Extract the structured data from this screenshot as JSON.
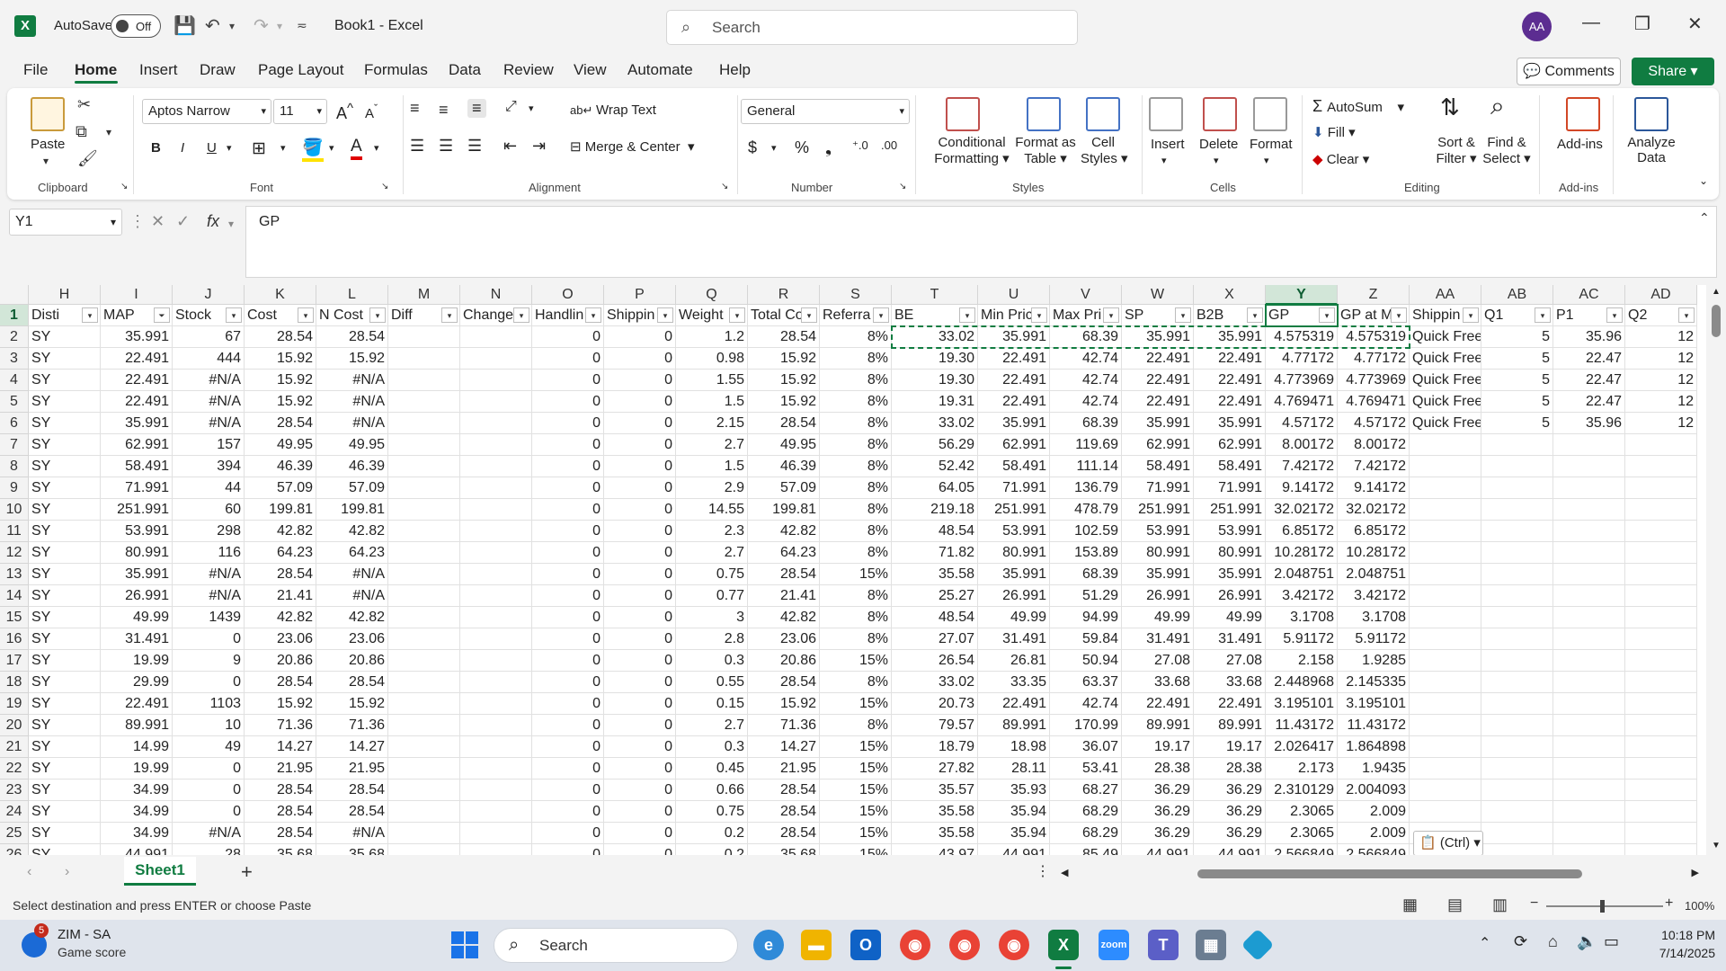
{
  "titlebar": {
    "autosave_label": "AutoSave",
    "autosave_state": "Off",
    "book_title": "Book1  -  Excel",
    "search_placeholder": "Search",
    "avatar_initials": "AA"
  },
  "menu": [
    "File",
    "Home",
    "Insert",
    "Draw",
    "Page Layout",
    "Formulas",
    "Data",
    "Review",
    "View",
    "Automate",
    "Help"
  ],
  "actions": {
    "comments": "Comments",
    "share": "Share"
  },
  "ribbon": {
    "clipboard": {
      "paste": "Paste",
      "label": "Clipboard"
    },
    "font": {
      "name": "Aptos Narrow",
      "size": "11",
      "label": "Font"
    },
    "alignment": {
      "wrap": "Wrap Text",
      "merge": "Merge & Center",
      "label": "Alignment"
    },
    "number": {
      "format": "General",
      "label": "Number"
    },
    "styles": {
      "conditional": [
        "Conditional",
        "Formatting"
      ],
      "format_table": [
        "Format as",
        "Table"
      ],
      "cell_styles": [
        "Cell",
        "Styles"
      ],
      "label": "Styles"
    },
    "cells": {
      "insert": "Insert",
      "delete": "Delete",
      "format": "Format",
      "label": "Cells"
    },
    "editing": {
      "autosum": "AutoSum",
      "fill": "Fill",
      "clear": "Clear",
      "sort": [
        "Sort &",
        "Filter"
      ],
      "find": [
        "Find &",
        "Select"
      ],
      "label": "Editing"
    },
    "addins": {
      "addins": "Add-ins",
      "label": "Add-ins",
      "analyze": [
        "Analyze",
        "Data"
      ]
    }
  },
  "formula_bar": {
    "name_box": "Y1",
    "fx": "fx",
    "content": "GP"
  },
  "columns": [
    {
      "letter": "H",
      "w": 80,
      "header": "Disti",
      "txt": true
    },
    {
      "letter": "I",
      "w": 80,
      "header": "MAP"
    },
    {
      "letter": "J",
      "w": 80,
      "header": "Stock"
    },
    {
      "letter": "K",
      "w": 80,
      "header": "Cost"
    },
    {
      "letter": "L",
      "w": 80,
      "header": "N Cost"
    },
    {
      "letter": "M",
      "w": 80,
      "header": "Diff"
    },
    {
      "letter": "N",
      "w": 80,
      "header": "Change"
    },
    {
      "letter": "O",
      "w": 80,
      "header": "Handlin"
    },
    {
      "letter": "P",
      "w": 80,
      "header": "Shippin"
    },
    {
      "letter": "Q",
      "w": 80,
      "header": "Weight"
    },
    {
      "letter": "R",
      "w": 80,
      "header": "Total Co"
    },
    {
      "letter": "S",
      "w": 80,
      "header": "Referra"
    },
    {
      "letter": "T",
      "w": 96,
      "header": "BE"
    },
    {
      "letter": "U",
      "w": 80,
      "header": "Min Pric"
    },
    {
      "letter": "V",
      "w": 80,
      "header": "Max Pri"
    },
    {
      "letter": "W",
      "w": 80,
      "header": "SP"
    },
    {
      "letter": "X",
      "w": 80,
      "header": "B2B"
    },
    {
      "letter": "Y",
      "w": 80,
      "header": "GP"
    },
    {
      "letter": "Z",
      "w": 80,
      "header": "GP at M"
    },
    {
      "letter": "AA",
      "w": 80,
      "header": "Shippin",
      "txt": true
    },
    {
      "letter": "AB",
      "w": 80,
      "header": "Q1"
    },
    {
      "letter": "AC",
      "w": 80,
      "header": "P1"
    },
    {
      "letter": "AD",
      "w": 80,
      "header": "Q2"
    }
  ],
  "rows": [
    {
      "n": "2",
      "c": [
        "SY",
        "35.991",
        "67",
        "28.54",
        "28.54",
        "",
        "",
        "0",
        "0",
        "1.2",
        "28.54",
        "8%",
        "33.02",
        "35.991",
        "68.39",
        "35.991",
        "35.991",
        "4.575319",
        "4.575319",
        "Quick Free",
        "5",
        "35.96",
        "12"
      ]
    },
    {
      "n": "3",
      "c": [
        "SY",
        "22.491",
        "444",
        "15.92",
        "15.92",
        "",
        "",
        "0",
        "0",
        "0.98",
        "15.92",
        "8%",
        "19.30",
        "22.491",
        "42.74",
        "22.491",
        "22.491",
        "4.77172",
        "4.77172",
        "Quick Free",
        "5",
        "22.47",
        "12"
      ]
    },
    {
      "n": "4",
      "c": [
        "SY",
        "22.491",
        "#N/A",
        "15.92",
        "#N/A",
        "",
        "",
        "0",
        "0",
        "1.55",
        "15.92",
        "8%",
        "19.30",
        "22.491",
        "42.74",
        "22.491",
        "22.491",
        "4.773969",
        "4.773969",
        "Quick Free",
        "5",
        "22.47",
        "12"
      ]
    },
    {
      "n": "5",
      "c": [
        "SY",
        "22.491",
        "#N/A",
        "15.92",
        "#N/A",
        "",
        "",
        "0",
        "0",
        "1.5",
        "15.92",
        "8%",
        "19.31",
        "22.491",
        "42.74",
        "22.491",
        "22.491",
        "4.769471",
        "4.769471",
        "Quick Free",
        "5",
        "22.47",
        "12"
      ]
    },
    {
      "n": "6",
      "c": [
        "SY",
        "35.991",
        "#N/A",
        "28.54",
        "#N/A",
        "",
        "",
        "0",
        "0",
        "2.15",
        "28.54",
        "8%",
        "33.02",
        "35.991",
        "68.39",
        "35.991",
        "35.991",
        "4.57172",
        "4.57172",
        "Quick Free",
        "5",
        "35.96",
        "12"
      ]
    },
    {
      "n": "7",
      "c": [
        "SY",
        "62.991",
        "157",
        "49.95",
        "49.95",
        "",
        "",
        "0",
        "0",
        "2.7",
        "49.95",
        "8%",
        "56.29",
        "62.991",
        "119.69",
        "62.991",
        "62.991",
        "8.00172",
        "8.00172",
        "",
        "",
        "",
        ""
      ]
    },
    {
      "n": "8",
      "c": [
        "SY",
        "58.491",
        "394",
        "46.39",
        "46.39",
        "",
        "",
        "0",
        "0",
        "1.5",
        "46.39",
        "8%",
        "52.42",
        "58.491",
        "111.14",
        "58.491",
        "58.491",
        "7.42172",
        "7.42172",
        "",
        "",
        "",
        ""
      ]
    },
    {
      "n": "9",
      "c": [
        "SY",
        "71.991",
        "44",
        "57.09",
        "57.09",
        "",
        "",
        "0",
        "0",
        "2.9",
        "57.09",
        "8%",
        "64.05",
        "71.991",
        "136.79",
        "71.991",
        "71.991",
        "9.14172",
        "9.14172",
        "",
        "",
        "",
        ""
      ]
    },
    {
      "n": "10",
      "c": [
        "SY",
        "251.991",
        "60",
        "199.81",
        "199.81",
        "",
        "",
        "0",
        "0",
        "14.55",
        "199.81",
        "8%",
        "219.18",
        "251.991",
        "478.79",
        "251.991",
        "251.991",
        "32.02172",
        "32.02172",
        "",
        "",
        "",
        ""
      ]
    },
    {
      "n": "11",
      "c": [
        "SY",
        "53.991",
        "298",
        "42.82",
        "42.82",
        "",
        "",
        "0",
        "0",
        "2.3",
        "42.82",
        "8%",
        "48.54",
        "53.991",
        "102.59",
        "53.991",
        "53.991",
        "6.85172",
        "6.85172",
        "",
        "",
        "",
        ""
      ]
    },
    {
      "n": "12",
      "c": [
        "SY",
        "80.991",
        "116",
        "64.23",
        "64.23",
        "",
        "",
        "0",
        "0",
        "2.7",
        "64.23",
        "8%",
        "71.82",
        "80.991",
        "153.89",
        "80.991",
        "80.991",
        "10.28172",
        "10.28172",
        "",
        "",
        "",
        ""
      ]
    },
    {
      "n": "13",
      "c": [
        "SY",
        "35.991",
        "#N/A",
        "28.54",
        "#N/A",
        "",
        "",
        "0",
        "0",
        "0.75",
        "28.54",
        "15%",
        "35.58",
        "35.991",
        "68.39",
        "35.991",
        "35.991",
        "2.048751",
        "2.048751",
        "",
        "",
        "",
        ""
      ]
    },
    {
      "n": "14",
      "c": [
        "SY",
        "26.991",
        "#N/A",
        "21.41",
        "#N/A",
        "",
        "",
        "0",
        "0",
        "0.77",
        "21.41",
        "8%",
        "25.27",
        "26.991",
        "51.29",
        "26.991",
        "26.991",
        "3.42172",
        "3.42172",
        "",
        "",
        "",
        ""
      ]
    },
    {
      "n": "15",
      "c": [
        "SY",
        "49.99",
        "1439",
        "42.82",
        "42.82",
        "",
        "",
        "0",
        "0",
        "3",
        "42.82",
        "8%",
        "48.54",
        "49.99",
        "94.99",
        "49.99",
        "49.99",
        "3.1708",
        "3.1708",
        "",
        "",
        "",
        ""
      ]
    },
    {
      "n": "16",
      "c": [
        "SY",
        "31.491",
        "0",
        "23.06",
        "23.06",
        "",
        "",
        "0",
        "0",
        "2.8",
        "23.06",
        "8%",
        "27.07",
        "31.491",
        "59.84",
        "31.491",
        "31.491",
        "5.91172",
        "5.91172",
        "",
        "",
        "",
        ""
      ]
    },
    {
      "n": "17",
      "c": [
        "SY",
        "19.99",
        "9",
        "20.86",
        "20.86",
        "",
        "",
        "0",
        "0",
        "0.3",
        "20.86",
        "15%",
        "26.54",
        "26.81",
        "50.94",
        "27.08",
        "27.08",
        "2.158",
        "1.9285",
        "",
        "",
        "",
        ""
      ]
    },
    {
      "n": "18",
      "c": [
        "SY",
        "29.99",
        "0",
        "28.54",
        "28.54",
        "",
        "",
        "0",
        "0",
        "0.55",
        "28.54",
        "8%",
        "33.02",
        "33.35",
        "63.37",
        "33.68",
        "33.68",
        "2.448968",
        "2.145335",
        "",
        "",
        "",
        ""
      ]
    },
    {
      "n": "19",
      "c": [
        "SY",
        "22.491",
        "1103",
        "15.92",
        "15.92",
        "",
        "",
        "0",
        "0",
        "0.15",
        "15.92",
        "15%",
        "20.73",
        "22.491",
        "42.74",
        "22.491",
        "22.491",
        "3.195101",
        "3.195101",
        "",
        "",
        "",
        ""
      ]
    },
    {
      "n": "20",
      "c": [
        "SY",
        "89.991",
        "10",
        "71.36",
        "71.36",
        "",
        "",
        "0",
        "0",
        "2.7",
        "71.36",
        "8%",
        "79.57",
        "89.991",
        "170.99",
        "89.991",
        "89.991",
        "11.43172",
        "11.43172",
        "",
        "",
        "",
        ""
      ]
    },
    {
      "n": "21",
      "c": [
        "SY",
        "14.99",
        "49",
        "14.27",
        "14.27",
        "",
        "",
        "0",
        "0",
        "0.3",
        "14.27",
        "15%",
        "18.79",
        "18.98",
        "36.07",
        "19.17",
        "19.17",
        "2.026417",
        "1.864898",
        "",
        "",
        "",
        ""
      ]
    },
    {
      "n": "22",
      "c": [
        "SY",
        "19.99",
        "0",
        "21.95",
        "21.95",
        "",
        "",
        "0",
        "0",
        "0.45",
        "21.95",
        "15%",
        "27.82",
        "28.11",
        "53.41",
        "28.38",
        "28.38",
        "2.173",
        "1.9435",
        "",
        "",
        "",
        ""
      ]
    },
    {
      "n": "23",
      "c": [
        "SY",
        "34.99",
        "0",
        "28.54",
        "28.54",
        "",
        "",
        "0",
        "0",
        "0.66",
        "28.54",
        "15%",
        "35.57",
        "35.93",
        "68.27",
        "36.29",
        "36.29",
        "2.310129",
        "2.004093",
        "",
        "",
        "",
        ""
      ]
    },
    {
      "n": "24",
      "c": [
        "SY",
        "34.99",
        "0",
        "28.54",
        "28.54",
        "",
        "",
        "0",
        "0",
        "0.75",
        "28.54",
        "15%",
        "35.58",
        "35.94",
        "68.29",
        "36.29",
        "36.29",
        "2.3065",
        "2.009",
        "",
        "",
        "",
        ""
      ]
    },
    {
      "n": "25",
      "c": [
        "SY",
        "34.99",
        "#N/A",
        "28.54",
        "#N/A",
        "",
        "",
        "0",
        "0",
        "0.2",
        "28.54",
        "15%",
        "35.58",
        "35.94",
        "68.29",
        "36.29",
        "36.29",
        "2.3065",
        "2.009",
        "",
        "",
        "",
        ""
      ]
    },
    {
      "n": "26",
      "c": [
        "SY",
        "44.991",
        "28",
        "35.68",
        "35.68",
        "",
        "",
        "0",
        "0",
        "0.2",
        "35.68",
        "15%",
        "43.97",
        "44.991",
        "85.49",
        "44.991",
        "44.991",
        "2.566849",
        "2.566849",
        "",
        "",
        "",
        ""
      ]
    }
  ],
  "paste_ctrl": "(Ctrl)",
  "sheet_tab": "Sheet1",
  "status": {
    "message": "Select destination and press ENTER or choose Paste",
    "zoom": "100%"
  },
  "taskbar": {
    "news_title": "ZIM - SA",
    "news_sub": "Game score",
    "news_badge": "5",
    "search": "Search",
    "time": "10:18 PM",
    "date": "7/14/2025"
  },
  "colors": {
    "accent": "#107c41"
  }
}
